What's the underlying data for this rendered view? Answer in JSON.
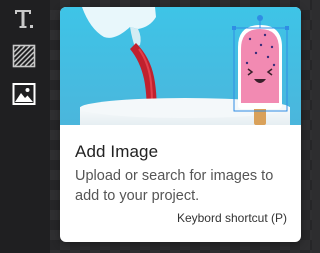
{
  "toolbar": {
    "tools": [
      {
        "name": "text-tool",
        "icon": "text-icon",
        "active": false
      },
      {
        "name": "texture-tool",
        "icon": "diagonal-hatch-icon",
        "active": false
      },
      {
        "name": "image-tool",
        "icon": "image-icon",
        "active": true
      }
    ]
  },
  "tooltip": {
    "title": "Add Image",
    "description": "Upload or search for images to add to your project.",
    "shortcut": "Keybord shortcut (P)"
  },
  "colors": {
    "hero_background": "#3fc3e6",
    "popsicle_pink": "#f28ab2",
    "stream_red": "#c0212e",
    "selection_blue": "#2f8de4"
  }
}
